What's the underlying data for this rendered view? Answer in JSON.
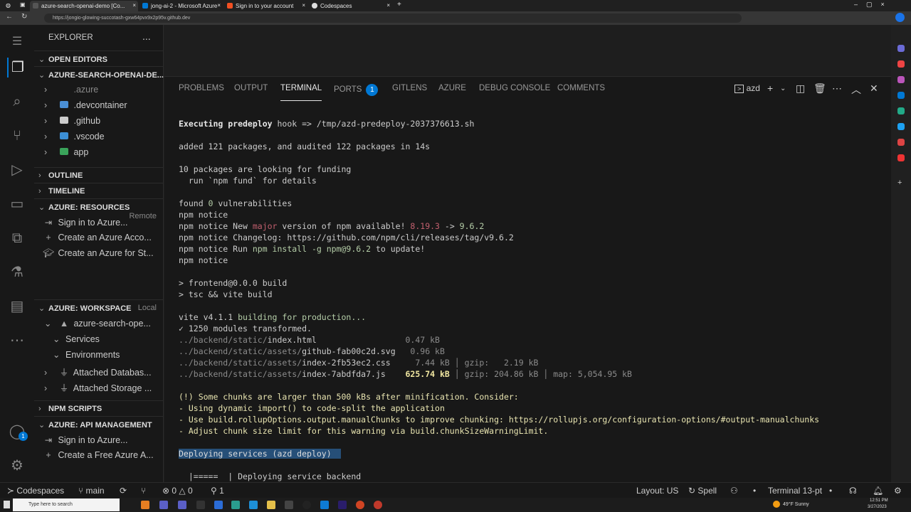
{
  "browser": {
    "tabs": [
      {
        "title": "azure-search-openai-demo [Co...",
        "color": "#555"
      },
      {
        "title": "jong-ai-2 - Microsoft Azure",
        "color": "#0078d4"
      },
      {
        "title": "Sign in to your account",
        "color": "#f25022"
      },
      {
        "title": "Codespaces",
        "color": "#ddd"
      }
    ],
    "url": "https://jongio-glowing-succotash-gxw64pvx9x2p95v.github.dev"
  },
  "sidebar": {
    "title": "EXPLORER",
    "more": "...",
    "open_editors": "OPEN EDITORS",
    "project": "AZURE-SEARCH-OPENAI-DE...",
    "files": [
      {
        "name": ".azure",
        "icon": "folder-icon"
      },
      {
        "name": ".devcontainer",
        "icon": "devcontainer-folder-icon"
      },
      {
        "name": ".github",
        "icon": "github-folder-icon"
      },
      {
        "name": ".vscode",
        "icon": "vscode-folder-icon"
      },
      {
        "name": "app",
        "icon": "app-folder-icon"
      }
    ],
    "outline": "OUTLINE",
    "timeline": "TIMELINE",
    "resources": {
      "title": "AZURE: RESOURCES",
      "aux": "Remote",
      "items": [
        "Sign in to Azure...",
        "Create an Azure Acco...",
        "Create an Azure for St..."
      ]
    },
    "workspace": {
      "title": "AZURE: WORKSPACE",
      "aux": "Local",
      "root": "azure-search-ope...",
      "items": [
        "Services",
        "Environments",
        "Attached Databas...",
        "Attached Storage ..."
      ]
    },
    "npm": "NPM SCRIPTS",
    "apim": {
      "title": "AZURE: API MANAGEMENT",
      "items": [
        "Sign in to Azure...",
        "Create a Free Azure A..."
      ]
    }
  },
  "activity": {
    "accounts_badge": "1"
  },
  "panel": {
    "tabs": [
      "PROBLEMS",
      "OUTPUT",
      "TERMINAL",
      "PORTS",
      "GITLENS",
      "AZURE",
      "DEBUG CONSOLE",
      "COMMENTS"
    ],
    "ports_badge": "1",
    "active_tab": "TERMINAL",
    "terminal_name": "azd"
  },
  "terminal": {
    "lines": [
      [
        {
          "t": "Executing predeploy",
          "c": "bold"
        },
        {
          "t": " hook => /tmp/azd-predeploy-2037376613.sh"
        }
      ],
      [],
      [
        {
          "t": "added 121 packages, and audited 122 packages in 14s"
        }
      ],
      [],
      [
        {
          "t": "10 packages are looking for funding"
        }
      ],
      [
        {
          "t": "  run `npm fund` for details"
        }
      ],
      [],
      [
        {
          "t": "found "
        },
        {
          "t": "0",
          "c": "num"
        },
        {
          "t": " vulnerabilities"
        }
      ],
      [
        {
          "t": "npm notice"
        }
      ],
      [
        {
          "t": "npm notice New "
        },
        {
          "t": "major",
          "c": "red"
        },
        {
          "t": " version of npm available! "
        },
        {
          "t": "8.19.3",
          "c": "red"
        },
        {
          "t": " -> "
        },
        {
          "t": "9.6.2",
          "c": "num"
        }
      ],
      [
        {
          "t": "npm notice Changelog: https://github.com/npm/cli/releases/tag/v9.6.2"
        }
      ],
      [
        {
          "t": "npm notice Run "
        },
        {
          "t": "npm install -g npm@9.6.2",
          "c": "num"
        },
        {
          "t": " to update!"
        }
      ],
      [
        {
          "t": "npm notice"
        }
      ],
      [],
      [
        {
          "t": "> frontend@0.0.0 build"
        }
      ],
      [
        {
          "t": "> tsc && vite build"
        }
      ],
      [],
      [
        {
          "t": "vite v4.1.1 "
        },
        {
          "t": "building for production...",
          "c": "num"
        }
      ],
      [
        {
          "t": "✓ 1250 modules transformed."
        }
      ],
      [
        {
          "t": "../backend/static/",
          "c": "dim"
        },
        {
          "t": "index.html"
        },
        {
          "t": "                  0.47 kB",
          "c": "dim"
        }
      ],
      [
        {
          "t": "../backend/static/assets/",
          "c": "dim"
        },
        {
          "t": "github-fab00c2d.svg"
        },
        {
          "t": "   0.96 kB",
          "c": "dim"
        }
      ],
      [
        {
          "t": "../backend/static/assets/",
          "c": "dim"
        },
        {
          "t": "index-2fb53ec2.css"
        },
        {
          "t": "     7.44 kB │ gzip:   2.19 kB",
          "c": "dim"
        }
      ],
      [
        {
          "t": "../backend/static/assets/",
          "c": "dim"
        },
        {
          "t": "index-7abdfda7.js"
        },
        {
          "t": "    "
        },
        {
          "t": "625.74 kB",
          "c": "ybold"
        },
        {
          "t": " │ gzip: 204.86 kB │ map: 5,054.95 kB",
          "c": "dim"
        }
      ],
      [],
      [
        {
          "t": "(!) Some chunks are larger than 500 kBs after minification. Consider:",
          "c": "yellow"
        }
      ],
      [
        {
          "t": "- Using dynamic import() to code-split the application",
          "c": "yellow"
        }
      ],
      [
        {
          "t": "- Use build.rollupOptions.output.manualChunks to improve chunking: https://rollupjs.org/configuration-options/#output-manualchunks",
          "c": "yellow"
        }
      ],
      [
        {
          "t": "- Adjust chunk size limit for this warning via build.chunkSizeWarningLimit.",
          "c": "yellow"
        }
      ],
      [],
      [
        {
          "t": "Deploying services (azd deploy)  ",
          "c": "sel"
        }
      ],
      [],
      [
        {
          "t": "  |=====  | Deploying service backend"
        }
      ]
    ]
  },
  "status": {
    "remote": "Codespaces",
    "branch": "main",
    "errors": "0",
    "warnings": "0",
    "ports": "1",
    "layout": "Layout: US",
    "spell": "Spell",
    "terminal": "Terminal 13-pt"
  },
  "taskbar": {
    "search_placeholder": "Type here to search",
    "weather": "49°F Sunny",
    "time": "12:51 PM",
    "date": "3/27/2023"
  }
}
